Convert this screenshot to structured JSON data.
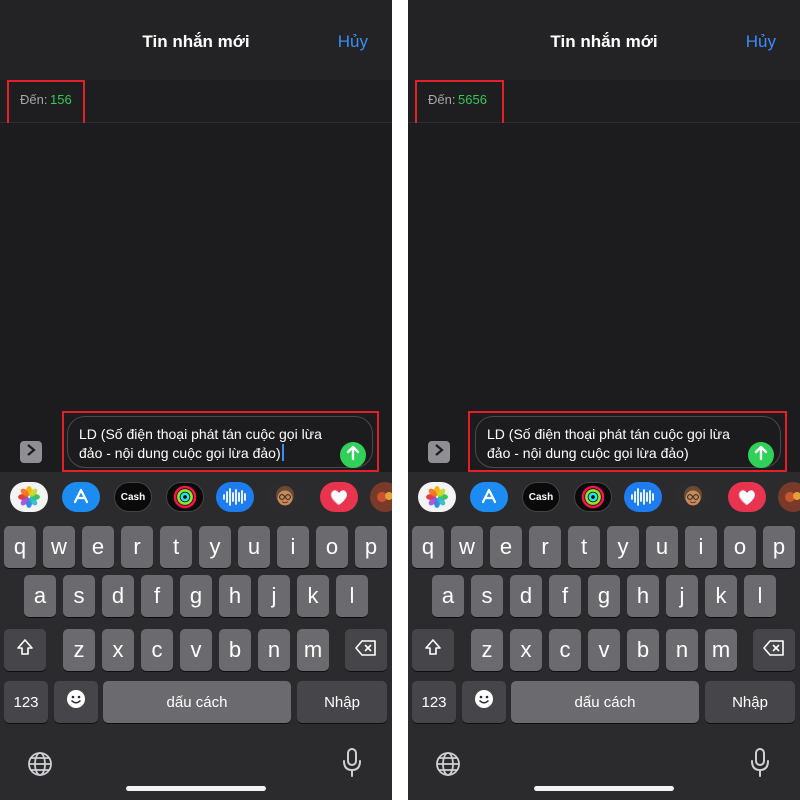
{
  "screens": [
    {
      "nav_title": "Tin nhắn mới",
      "cancel_label": "Hủy",
      "to_label": "Đến:",
      "to_value": "156",
      "message": "LD (Số điện thoại phát tán cuộc gọi lừa đảo - nội dung cuộc gọi lừa đảo)"
    },
    {
      "nav_title": "Tin nhắn mới",
      "cancel_label": "Hủy",
      "to_label": "Đến:",
      "to_value": "5656",
      "message": "LD (Số điện thoại phát tán cuộc gọi lừa đảo - nội dung cuộc gọi lừa đảo)"
    }
  ],
  "app_strip": [
    "photos-icon",
    "app-store-icon",
    "apple-cash-icon",
    "fitness-icon",
    "audio-message-icon",
    "memoji-icon",
    "heart-sticker-icon",
    "more-apps-icon"
  ],
  "apple_cash_label": "Cash",
  "keyboard": {
    "row1": [
      "q",
      "w",
      "e",
      "r",
      "t",
      "y",
      "u",
      "i",
      "o",
      "p"
    ],
    "row2": [
      "a",
      "s",
      "d",
      "f",
      "g",
      "h",
      "j",
      "k",
      "l"
    ],
    "row3": [
      "z",
      "x",
      "c",
      "v",
      "b",
      "n",
      "m"
    ],
    "numbers_label": "123",
    "space_label": "dấu cách",
    "return_label": "Nhập"
  },
  "colors": {
    "accent_blue": "#3a8cf7",
    "recipient_green": "#34c759",
    "send_green": "#30d158",
    "highlight_red": "#e3202a"
  }
}
